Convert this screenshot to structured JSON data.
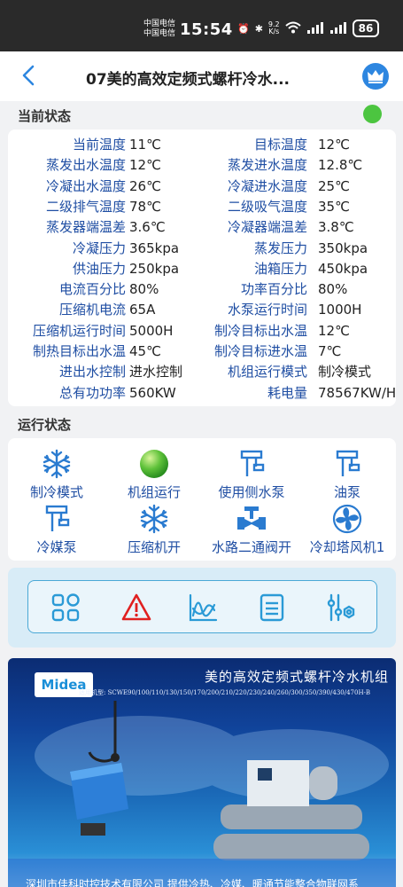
{
  "statusbar": {
    "carrier1": "中国电信",
    "carrier2": "中国电信",
    "time": "15:54",
    "netspeed_value": "9.2",
    "netspeed_unit": "K/s",
    "battery": "86"
  },
  "header": {
    "title": "07美的高效定频式螺杆冷水..."
  },
  "current_status": {
    "heading": "当前状态",
    "indicator_color": "#4cc540",
    "rows": [
      {
        "l_label": "当前温度",
        "l_value": "11℃",
        "r_label": "目标温度",
        "r_value": "12℃"
      },
      {
        "l_label": "蒸发出水温度",
        "l_value": "12℃",
        "r_label": "蒸发进水温度",
        "r_value": "12.8℃"
      },
      {
        "l_label": "冷凝出水温度",
        "l_value": "26℃",
        "r_label": "冷凝进水温度",
        "r_value": "25℃"
      },
      {
        "l_label": "二级排气温度",
        "l_value": "78℃",
        "r_label": "二级吸气温度",
        "r_value": "35℃"
      },
      {
        "l_label": "蒸发器端温差",
        "l_value": "3.6℃",
        "r_label": "冷凝器端温差",
        "r_value": "3.8℃"
      },
      {
        "l_label": "冷凝压力",
        "l_value": "365kpa",
        "r_label": "蒸发压力",
        "r_value": "350kpa"
      },
      {
        "l_label": "供油压力",
        "l_value": "250kpa",
        "r_label": "油箱压力",
        "r_value": "450kpa"
      },
      {
        "l_label": "电流百分比",
        "l_value": "80%",
        "r_label": "功率百分比",
        "r_value": "80%"
      },
      {
        "l_label": "压缩机电流",
        "l_value": "65A",
        "r_label": "水泵运行时间",
        "r_value": "1000H"
      },
      {
        "l_label": "压缩机运行时间",
        "l_value": "5000H",
        "r_label": "制冷目标出水温",
        "r_value": "12℃"
      },
      {
        "l_label": "制热目标出水温",
        "l_value": "45℃",
        "r_label": "制冷目标进水温",
        "r_value": "7℃"
      },
      {
        "l_label": "进出水控制",
        "l_value": "进水控制",
        "r_label": "机组运行模式",
        "r_value": "制冷模式"
      },
      {
        "l_label": "总有功功率",
        "l_value": "560KW",
        "r_label": "耗电量",
        "r_value": "78567KW/H"
      }
    ]
  },
  "run_status": {
    "heading": "运行状态",
    "items": [
      {
        "label": "制冷模式",
        "icon": "snowflake-icon"
      },
      {
        "label": "机组运行",
        "icon": "green-ball-icon"
      },
      {
        "label": "使用侧水泵",
        "icon": "pump-icon"
      },
      {
        "label": "油泵",
        "icon": "pump-icon"
      },
      {
        "label": "冷媒泵",
        "icon": "pump-icon"
      },
      {
        "label": "压缩机开",
        "icon": "snowflake-icon"
      },
      {
        "label": "水路二通阀开",
        "icon": "valve-icon"
      },
      {
        "label": "冷却塔风机1",
        "icon": "fan-icon"
      }
    ]
  },
  "toolbar": {
    "accent": "#2a9ad6",
    "warning": "#e02020",
    "items": [
      "grid-icon",
      "warning-icon",
      "trend-chart-icon",
      "list-icon",
      "settings-sliders-icon"
    ]
  },
  "banner": {
    "logo": "Midea",
    "title": "美的高效定频式螺杆冷水机组",
    "models": "适用机型: SCWE90/100/110/130/150/170/200/210/220/230/240/260/300/350/390/430/470H-B",
    "footer": "深圳市佳科时控技术有限公司   提供冷热、冷媒、暖通节能整合物联网系"
  }
}
